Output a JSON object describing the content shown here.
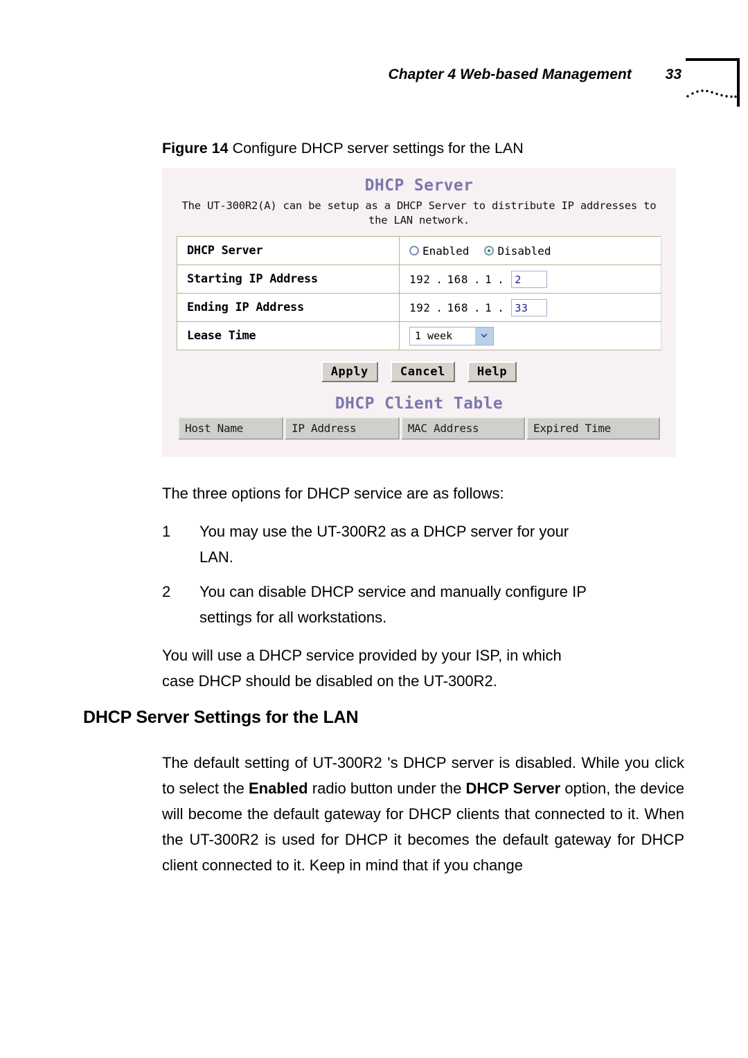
{
  "header": {
    "chapter_text": "Chapter 4 Web-based Management",
    "page_number": "33"
  },
  "figure": {
    "label": "Figure 14",
    "caption": " Configure DHCP server settings for the LAN"
  },
  "screenshot": {
    "title": "DHCP Server",
    "description": "The UT-300R2(A) can be setup as a DHCP Server to distribute IP addresses to the LAN network.",
    "colors": {
      "panel_background": "#f7f1f4",
      "heading_purple": "#7b77ab",
      "input_text_blue": "#1b1b8f",
      "radio_selected_green": "#13a013",
      "table_header_gray": "#cfcfcb"
    },
    "settings": {
      "dhcp_server": {
        "label": "DHCP Server",
        "options": [
          {
            "label": "Enabled",
            "selected": false
          },
          {
            "label": "Disabled",
            "selected": true
          }
        ]
      },
      "starting_ip": {
        "label": "Starting IP Address",
        "octet1": "192",
        "octet2": "168",
        "octet3": "1",
        "octet4_value": "2",
        "separator": "."
      },
      "ending_ip": {
        "label": "Ending IP Address",
        "octet1": "192",
        "octet2": "168",
        "octet3": "1",
        "octet4_value": "33",
        "separator": "."
      },
      "lease_time": {
        "label": "Lease Time",
        "selected_value": "1 week"
      }
    },
    "buttons": {
      "apply": "Apply",
      "cancel": "Cancel",
      "help": "Help"
    },
    "client_table": {
      "title": "DHCP Client Table",
      "columns": [
        "Host Name",
        "IP Address",
        "MAC Address",
        "Expired Time"
      ],
      "rows": []
    }
  },
  "body": {
    "intro": "The three options for DHCP service are as follows:",
    "list": [
      {
        "number": "1",
        "text": "You may use the UT-300R2 as a DHCP server for your",
        "last_line": "LAN."
      },
      {
        "number": "2",
        "text": "You can disable DHCP service and manually configure IP",
        "last_line": "settings for all workstations."
      }
    ],
    "isp_paragraph": "You will use a DHCP service provided by your ISP, in which",
    "isp_paragraph_last": "case DHCP should be disabled on the UT-300R2.",
    "section_heading": "DHCP Server Settings for the LAN",
    "final_paragraph": {
      "part1": "The default setting of UT-300R2 's DHCP server is disabled. While you click to select the ",
      "bold1": "Enabled",
      "part2": " radio button under the ",
      "bold2": "DHCP Server",
      "part3": " option, the device will become the default gateway for DHCP clients that connected to it. When the UT-300R2 is used for DHCP it becomes the default gateway for DHCP client connected to it. Keep in mind that if you change"
    }
  }
}
